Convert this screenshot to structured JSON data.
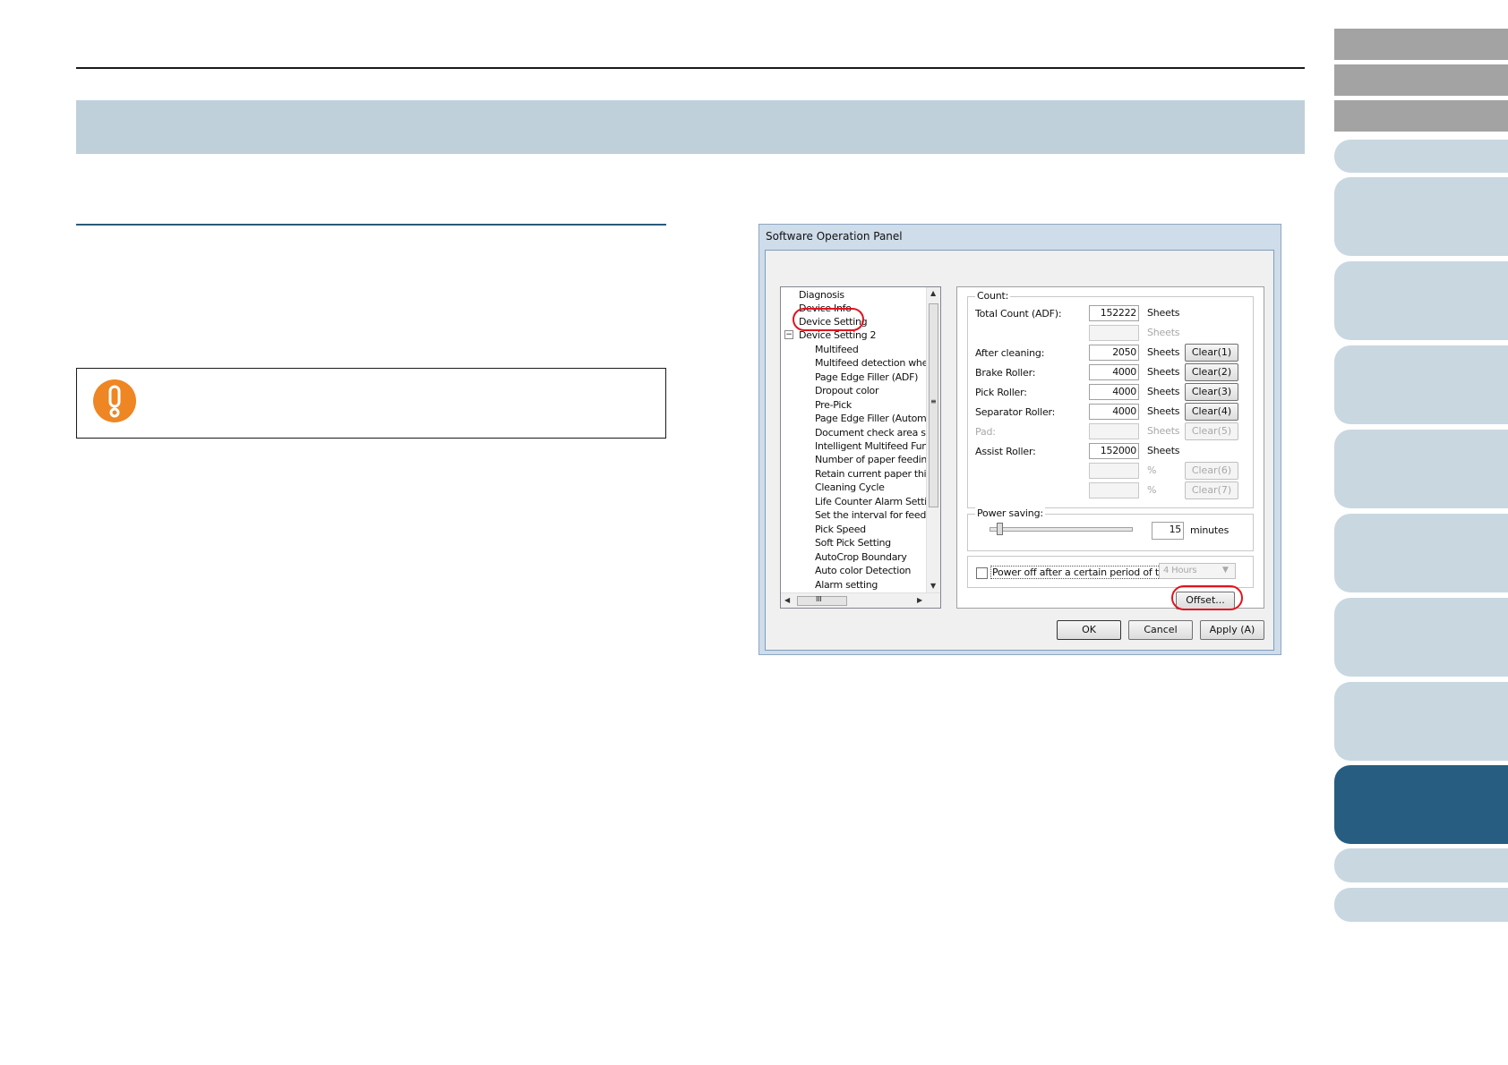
{
  "dialog": {
    "title": "Software Operation Panel",
    "tree": {
      "items": [
        "Diagnosis",
        "Device Info",
        "Device Setting",
        "Device Setting 2",
        "Multifeed",
        "Multifeed detection when s",
        "Page Edge Filler (ADF)",
        "Dropout color",
        "Pre-Pick",
        "Page Edge Filler (Automatic",
        "Document check area spe",
        "Intelligent Multifeed Functio",
        "Number of paper feeding re",
        "Retain current paper thickn",
        "Cleaning Cycle",
        "Life Counter Alarm Setting",
        "Set the interval for feeding",
        "Pick Speed",
        "Soft Pick Setting",
        "AutoCrop Boundary",
        "Auto color Detection",
        "Alarm setting"
      ],
      "expander": "−",
      "scroll_thumb_mark": "III",
      "vscroll_mark": "≡"
    },
    "count": {
      "group_label": "Count:",
      "unit": "Sheets",
      "percent": "%",
      "rows": [
        {
          "label": "Total Count (ADF):",
          "value": "152222",
          "button": ""
        },
        {
          "label": "",
          "value": "",
          "button": ""
        },
        {
          "label": "After cleaning:",
          "value": "2050",
          "button": "Clear(1)"
        },
        {
          "label": "Brake Roller:",
          "value": "4000",
          "button": "Clear(2)"
        },
        {
          "label": "Pick Roller:",
          "value": "4000",
          "button": "Clear(3)"
        },
        {
          "label": "Separator Roller:",
          "value": "4000",
          "button": "Clear(4)"
        },
        {
          "label": "Pad:",
          "value": "",
          "button": "Clear(5)"
        },
        {
          "label": "Assist Roller:",
          "value": "152000",
          "button": ""
        },
        {
          "label": "",
          "value": "",
          "button": "Clear(6)"
        },
        {
          "label": "",
          "value": "",
          "button": "Clear(7)"
        }
      ]
    },
    "power_saving": {
      "label": "Power saving:",
      "value": "15",
      "unit": "minutes",
      "power_off_label": "Power off after a certain period of time",
      "power_off_checked": false,
      "power_off_option": "4 Hours"
    },
    "offset_button": "Offset...",
    "buttons": {
      "ok": "OK",
      "cancel": "Cancel",
      "apply": "Apply (A)"
    }
  },
  "colors": {
    "title_band": "#bfd0da",
    "tab_gray": "#a3a3a3",
    "tab_light": "#c9d7e1",
    "tab_active": "#265d80",
    "caution_icon": "#ee8624",
    "highlight": "#e0141e"
  },
  "icons": {
    "caution": "caution-exclamation-icon"
  }
}
